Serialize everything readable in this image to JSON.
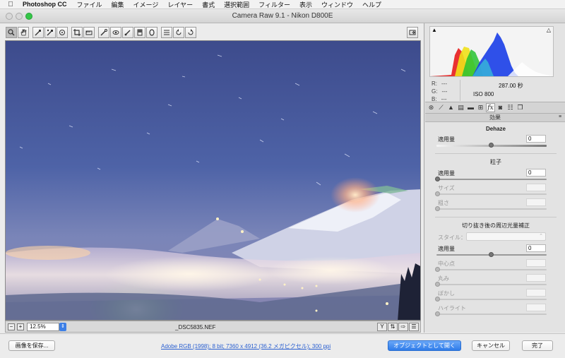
{
  "menubar": {
    "app_name": "Photoshop CC",
    "items": [
      "ファイル",
      "編集",
      "イメージ",
      "レイヤー",
      "書式",
      "選択範囲",
      "フィルター",
      "表示",
      "ウィンドウ",
      "ヘルプ"
    ]
  },
  "window": {
    "title": "Camera Raw 9.1  -  Nikon D800E"
  },
  "toolbar": {
    "tools": [
      {
        "icon": "zoom-icon",
        "glyph": "🔍"
      },
      {
        "icon": "hand-icon",
        "glyph": "✋"
      },
      {
        "icon": "white-balance-icon",
        "glyph": "⟋"
      },
      {
        "icon": "color-sampler-icon",
        "glyph": "⟋"
      },
      {
        "icon": "targeted-adjustment-icon",
        "glyph": "◎"
      },
      {
        "icon": "crop-icon",
        "glyph": "⌗"
      },
      {
        "icon": "straighten-icon",
        "glyph": "▭"
      },
      {
        "icon": "spot-removal-icon",
        "glyph": "⟋"
      },
      {
        "icon": "red-eye-icon",
        "glyph": "◉"
      },
      {
        "icon": "adjustment-brush-icon",
        "glyph": "⟋"
      },
      {
        "icon": "graduated-filter-icon",
        "glyph": "▯"
      },
      {
        "icon": "radial-filter-icon",
        "glyph": "◯"
      },
      {
        "icon": "preferences-icon",
        "glyph": "☰"
      },
      {
        "icon": "rotate-ccw-icon",
        "glyph": "↺"
      },
      {
        "icon": "rotate-cw-icon",
        "glyph": "↻"
      }
    ],
    "fullscreen_icon": "⇱"
  },
  "canvas_status": {
    "zoom": "12.5%",
    "filename": "_DSC5835.NEF"
  },
  "info": {
    "r_label": "R:",
    "g_label": "G:",
    "b_label": "B:",
    "r_value": "---",
    "g_value": "---",
    "b_value": "---",
    "shutter": "287.00 秒",
    "iso": "ISO 800"
  },
  "panel": {
    "section_title": "効果",
    "dehaze": {
      "title": "Dehaze",
      "amount_label": "適用量",
      "amount_value": "0"
    },
    "grain": {
      "title": "粒子",
      "amount_label": "適用量",
      "amount_value": "0",
      "size_label": "サイズ",
      "roughness_label": "粗さ"
    },
    "vignette": {
      "title": "切り抜き後の周辺光量補正",
      "style_label": "スタイル：",
      "amount_label": "適用量",
      "amount_value": "0",
      "midpoint_label": "中心点",
      "roundness_label": "丸み",
      "feather_label": "ぼかし",
      "highlights_label": "ハイライト"
    }
  },
  "bottom": {
    "save_label": "画像を保存...",
    "workflow_link": "Adobe RGB (1998); 8 bit; 7360 x 4912 (36.2 メガピクセル); 300 ppi",
    "open_object_label": "オブジェクトとして開く",
    "cancel_label": "キャンセル",
    "done_label": "完了"
  }
}
